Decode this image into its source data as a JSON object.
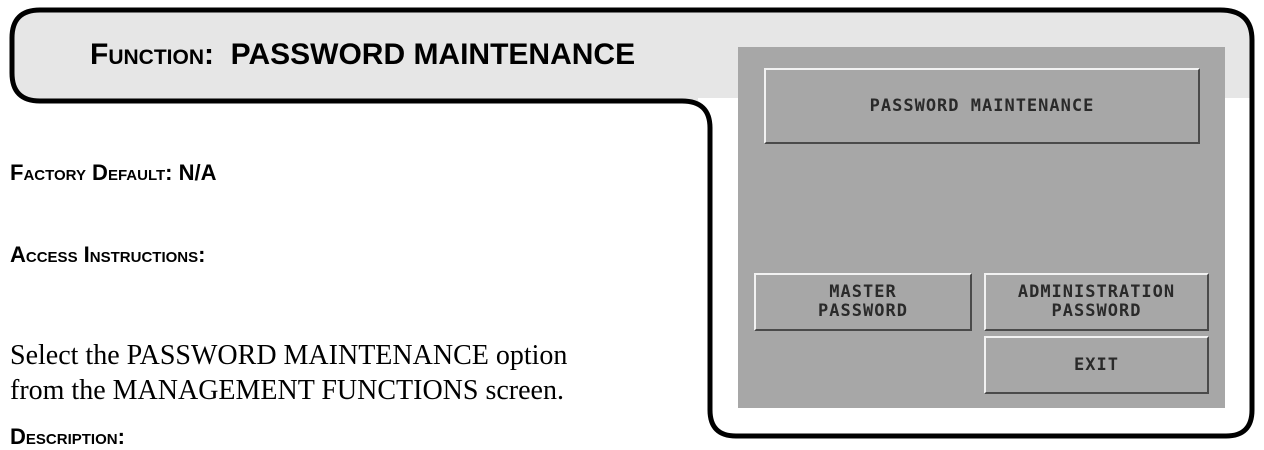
{
  "header": {
    "function_label": "Function:",
    "function_value": "PASSWORD MAINTENANCE"
  },
  "factory_default": {
    "label": "Factory Default:",
    "value": "N/A"
  },
  "access_instructions": {
    "label": "Access Instructions:",
    "line1": "Select the PASSWORD MAINTENANCE option",
    "line2": "from the MANAGEMENT FUNCTIONS screen."
  },
  "description": {
    "label": "Description:"
  },
  "screen": {
    "title_button": "PASSWORD MAINTENANCE",
    "master_button": "MASTER\nPASSWORD",
    "admin_button": "ADMINISTRATION\nPASSWORD",
    "exit_button": "EXIT"
  },
  "colors": {
    "tab_fill": "#e6e6e6",
    "screen_bg": "#a7a7a7",
    "frame_stroke": "#000000"
  }
}
